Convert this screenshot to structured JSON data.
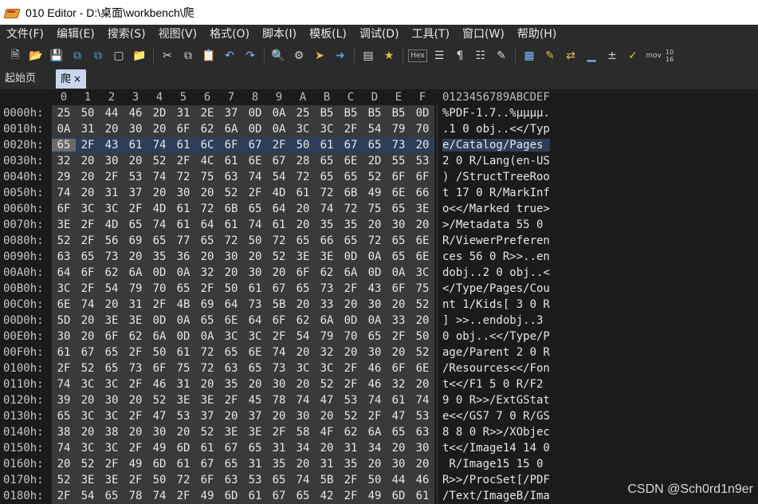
{
  "window": {
    "title": "010 Editor - D:\\桌面\\workbench\\爬"
  },
  "menu": [
    "文件(F)",
    "编辑(E)",
    "搜索(S)",
    "视图(V)",
    "格式(O)",
    "脚本(I)",
    "模板(L)",
    "调试(D)",
    "工具(T)",
    "窗口(W)",
    "帮助(H)"
  ],
  "toolbar": {
    "hex_label": "Hex",
    "mov_label": "mov",
    "small_label": "10 16"
  },
  "tabs": {
    "start": "起始页",
    "active": "爬",
    "close": "×"
  },
  "editor": {
    "columns": [
      "0",
      "1",
      "2",
      "3",
      "4",
      "5",
      "6",
      "7",
      "8",
      "9",
      "A",
      "B",
      "C",
      "D",
      "E",
      "F"
    ],
    "ascii_header": "0123456789ABCDEF",
    "rows": [
      {
        "addr": "0000h:",
        "hex": [
          "25",
          "50",
          "44",
          "46",
          "2D",
          "31",
          "2E",
          "37",
          "0D",
          "0A",
          "25",
          "B5",
          "B5",
          "B5",
          "B5",
          "0D"
        ],
        "ascii": "%PDF-1.7..%µµµµ."
      },
      {
        "addr": "0010h:",
        "hex": [
          "0A",
          "31",
          "20",
          "30",
          "20",
          "6F",
          "62",
          "6A",
          "0D",
          "0A",
          "3C",
          "3C",
          "2F",
          "54",
          "79",
          "70"
        ],
        "ascii": ".1 0 obj..<</Typ"
      },
      {
        "addr": "0020h:",
        "hex": [
          "65",
          "2F",
          "43",
          "61",
          "74",
          "61",
          "6C",
          "6F",
          "67",
          "2F",
          "50",
          "61",
          "67",
          "65",
          "73",
          "20"
        ],
        "ascii": "e/Catalog/Pages "
      },
      {
        "addr": "0030h:",
        "hex": [
          "32",
          "20",
          "30",
          "20",
          "52",
          "2F",
          "4C",
          "61",
          "6E",
          "67",
          "28",
          "65",
          "6E",
          "2D",
          "55",
          "53"
        ],
        "ascii": "2 0 R/Lang(en-US"
      },
      {
        "addr": "0040h:",
        "hex": [
          "29",
          "20",
          "2F",
          "53",
          "74",
          "72",
          "75",
          "63",
          "74",
          "54",
          "72",
          "65",
          "65",
          "52",
          "6F",
          "6F"
        ],
        "ascii": ") /StructTreeRoo"
      },
      {
        "addr": "0050h:",
        "hex": [
          "74",
          "20",
          "31",
          "37",
          "20",
          "30",
          "20",
          "52",
          "2F",
          "4D",
          "61",
          "72",
          "6B",
          "49",
          "6E",
          "66"
        ],
        "ascii": "t 17 0 R/MarkInf"
      },
      {
        "addr": "0060h:",
        "hex": [
          "6F",
          "3C",
          "3C",
          "2F",
          "4D",
          "61",
          "72",
          "6B",
          "65",
          "64",
          "20",
          "74",
          "72",
          "75",
          "65",
          "3E"
        ],
        "ascii": "o<</Marked true>"
      },
      {
        "addr": "0070h:",
        "hex": [
          "3E",
          "2F",
          "4D",
          "65",
          "74",
          "61",
          "64",
          "61",
          "74",
          "61",
          "20",
          "35",
          "35",
          "20",
          "30",
          "20"
        ],
        "ascii": ">/Metadata 55 0 "
      },
      {
        "addr": "0080h:",
        "hex": [
          "52",
          "2F",
          "56",
          "69",
          "65",
          "77",
          "65",
          "72",
          "50",
          "72",
          "65",
          "66",
          "65",
          "72",
          "65",
          "6E"
        ],
        "ascii": "R/ViewerPreferen"
      },
      {
        "addr": "0090h:",
        "hex": [
          "63",
          "65",
          "73",
          "20",
          "35",
          "36",
          "20",
          "30",
          "20",
          "52",
          "3E",
          "3E",
          "0D",
          "0A",
          "65",
          "6E"
        ],
        "ascii": "ces 56 0 R>>..en"
      },
      {
        "addr": "00A0h:",
        "hex": [
          "64",
          "6F",
          "62",
          "6A",
          "0D",
          "0A",
          "32",
          "20",
          "30",
          "20",
          "6F",
          "62",
          "6A",
          "0D",
          "0A",
          "3C"
        ],
        "ascii": "dobj..2 0 obj..<"
      },
      {
        "addr": "00B0h:",
        "hex": [
          "3C",
          "2F",
          "54",
          "79",
          "70",
          "65",
          "2F",
          "50",
          "61",
          "67",
          "65",
          "73",
          "2F",
          "43",
          "6F",
          "75"
        ],
        "ascii": "</Type/Pages/Cou"
      },
      {
        "addr": "00C0h:",
        "hex": [
          "6E",
          "74",
          "20",
          "31",
          "2F",
          "4B",
          "69",
          "64",
          "73",
          "5B",
          "20",
          "33",
          "20",
          "30",
          "20",
          "52"
        ],
        "ascii": "nt 1/Kids[ 3 0 R"
      },
      {
        "addr": "00D0h:",
        "hex": [
          "5D",
          "20",
          "3E",
          "3E",
          "0D",
          "0A",
          "65",
          "6E",
          "64",
          "6F",
          "62",
          "6A",
          "0D",
          "0A",
          "33",
          "20"
        ],
        "ascii": "] >>..endobj..3 "
      },
      {
        "addr": "00E0h:",
        "hex": [
          "30",
          "20",
          "6F",
          "62",
          "6A",
          "0D",
          "0A",
          "3C",
          "3C",
          "2F",
          "54",
          "79",
          "70",
          "65",
          "2F",
          "50"
        ],
        "ascii": "0 obj..<</Type/P"
      },
      {
        "addr": "00F0h:",
        "hex": [
          "61",
          "67",
          "65",
          "2F",
          "50",
          "61",
          "72",
          "65",
          "6E",
          "74",
          "20",
          "32",
          "20",
          "30",
          "20",
          "52"
        ],
        "ascii": "age/Parent 2 0 R"
      },
      {
        "addr": "0100h:",
        "hex": [
          "2F",
          "52",
          "65",
          "73",
          "6F",
          "75",
          "72",
          "63",
          "65",
          "73",
          "3C",
          "3C",
          "2F",
          "46",
          "6F",
          "6E"
        ],
        "ascii": "/Resources<</Fon"
      },
      {
        "addr": "0110h:",
        "hex": [
          "74",
          "3C",
          "3C",
          "2F",
          "46",
          "31",
          "20",
          "35",
          "20",
          "30",
          "20",
          "52",
          "2F",
          "46",
          "32",
          "20"
        ],
        "ascii": "t<</F1 5 0 R/F2 "
      },
      {
        "addr": "0120h:",
        "hex": [
          "39",
          "20",
          "30",
          "20",
          "52",
          "3E",
          "3E",
          "2F",
          "45",
          "78",
          "74",
          "47",
          "53",
          "74",
          "61",
          "74"
        ],
        "ascii": "9 0 R>>/ExtGStat"
      },
      {
        "addr": "0130h:",
        "hex": [
          "65",
          "3C",
          "3C",
          "2F",
          "47",
          "53",
          "37",
          "20",
          "37",
          "20",
          "30",
          "20",
          "52",
          "2F",
          "47",
          "53"
        ],
        "ascii": "e<</GS7 7 0 R/GS"
      },
      {
        "addr": "0140h:",
        "hex": [
          "38",
          "20",
          "38",
          "20",
          "30",
          "20",
          "52",
          "3E",
          "3E",
          "2F",
          "58",
          "4F",
          "62",
          "6A",
          "65",
          "63"
        ],
        "ascii": "8 8 0 R>>/XObjec"
      },
      {
        "addr": "0150h:",
        "hex": [
          "74",
          "3C",
          "3C",
          "2F",
          "49",
          "6D",
          "61",
          "67",
          "65",
          "31",
          "34",
          "20",
          "31",
          "34",
          "20",
          "30"
        ],
        "ascii": "t<</Image14 14 0"
      },
      {
        "addr": "0160h:",
        "hex": [
          "20",
          "52",
          "2F",
          "49",
          "6D",
          "61",
          "67",
          "65",
          "31",
          "35",
          "20",
          "31",
          "35",
          "20",
          "30",
          "20"
        ],
        "ascii": " R/Image15 15 0 "
      },
      {
        "addr": "0170h:",
        "hex": [
          "52",
          "3E",
          "3E",
          "2F",
          "50",
          "72",
          "6F",
          "63",
          "53",
          "65",
          "74",
          "5B",
          "2F",
          "50",
          "44",
          "46"
        ],
        "ascii": "R>>/ProcSet[/PDF"
      },
      {
        "addr": "0180h:",
        "hex": [
          "2F",
          "54",
          "65",
          "78",
          "74",
          "2F",
          "49",
          "6D",
          "61",
          "67",
          "65",
          "42",
          "2F",
          "49",
          "6D",
          "61"
        ],
        "ascii": "/Text/ImageB/Ima"
      }
    ]
  },
  "watermark": "CSDN @Sch0rd1n9er"
}
